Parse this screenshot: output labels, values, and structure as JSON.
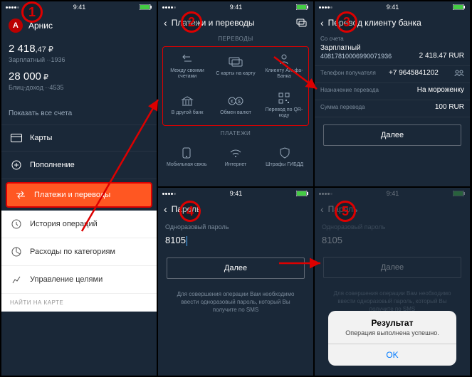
{
  "status": {
    "time": "9:41"
  },
  "steps": {
    "s1": "1",
    "s2": "2",
    "s3": "3",
    "s4": "4",
    "s5": "5"
  },
  "p1": {
    "name": "Арнис",
    "avatar_letter": "A",
    "bal1_int": "2 418",
    "bal1_dec": ",47 ₽",
    "bal1_label": "Зарплатный",
    "bal1_code": "··1936",
    "bal2_int": "28 000",
    "bal2_cur": " ₽",
    "bal2_label": "Блиц-доход",
    "bal2_code": "··4535",
    "show_all": "Показать все счета",
    "m_cards": "Карты",
    "m_topup": "Пополнение",
    "m_pay": "Платежи и переводы",
    "m_history": "История операций",
    "m_expenses": "Расходы по категориям",
    "m_goals": "Управление целями",
    "find_map": "НАЙТИ НА КАРТЕ"
  },
  "p2": {
    "title": "Платежи и переводы",
    "sec_transfers": "ПЕРЕВОДЫ",
    "sec_payments": "ПЛАТЕЖИ",
    "c1": "Между своими счетами",
    "c2": "С карты на карту",
    "c3": "Клиенту Альфа-Банка",
    "c4": "В другой банк",
    "c5": "Обмен валют",
    "c6": "Перевод по QR-коду",
    "c7": "Мобильная связь",
    "c8": "Интернет",
    "c9": "Штрафы ГИБДД"
  },
  "p3": {
    "title": "Перевод клиенту банка",
    "from_label": "Со счета",
    "from_name": "Зарплатный",
    "from_acct": "40817810006990071936",
    "from_amt": "2 418.47 RUR",
    "phone_label": "Телефон получателя",
    "phone": "+7 9645841202",
    "purpose_label": "Назначение перевода",
    "purpose": "На мороженку",
    "sum_label": "Сумма перевода",
    "sum": "100 RUR",
    "next": "Далее"
  },
  "p4": {
    "title": "Пароль",
    "otp_label": "Одноразовый пароль",
    "otp_value": "8105",
    "next": "Далее",
    "info": "Для совершения операции Вам необходимо ввести одноразовый пароль, который Вы получите по SMS"
  },
  "p5": {
    "title": "Пароль",
    "otp_label": "Одноразовый пароль",
    "otp_value": "8105",
    "next": "Далее",
    "info": "Для совершения операции Вам необходимо ввести одноразовый пароль, который Вы получите по SMS",
    "alert_title": "Результат",
    "alert_msg": "Операция выполнена успешно.",
    "alert_ok": "OK"
  }
}
